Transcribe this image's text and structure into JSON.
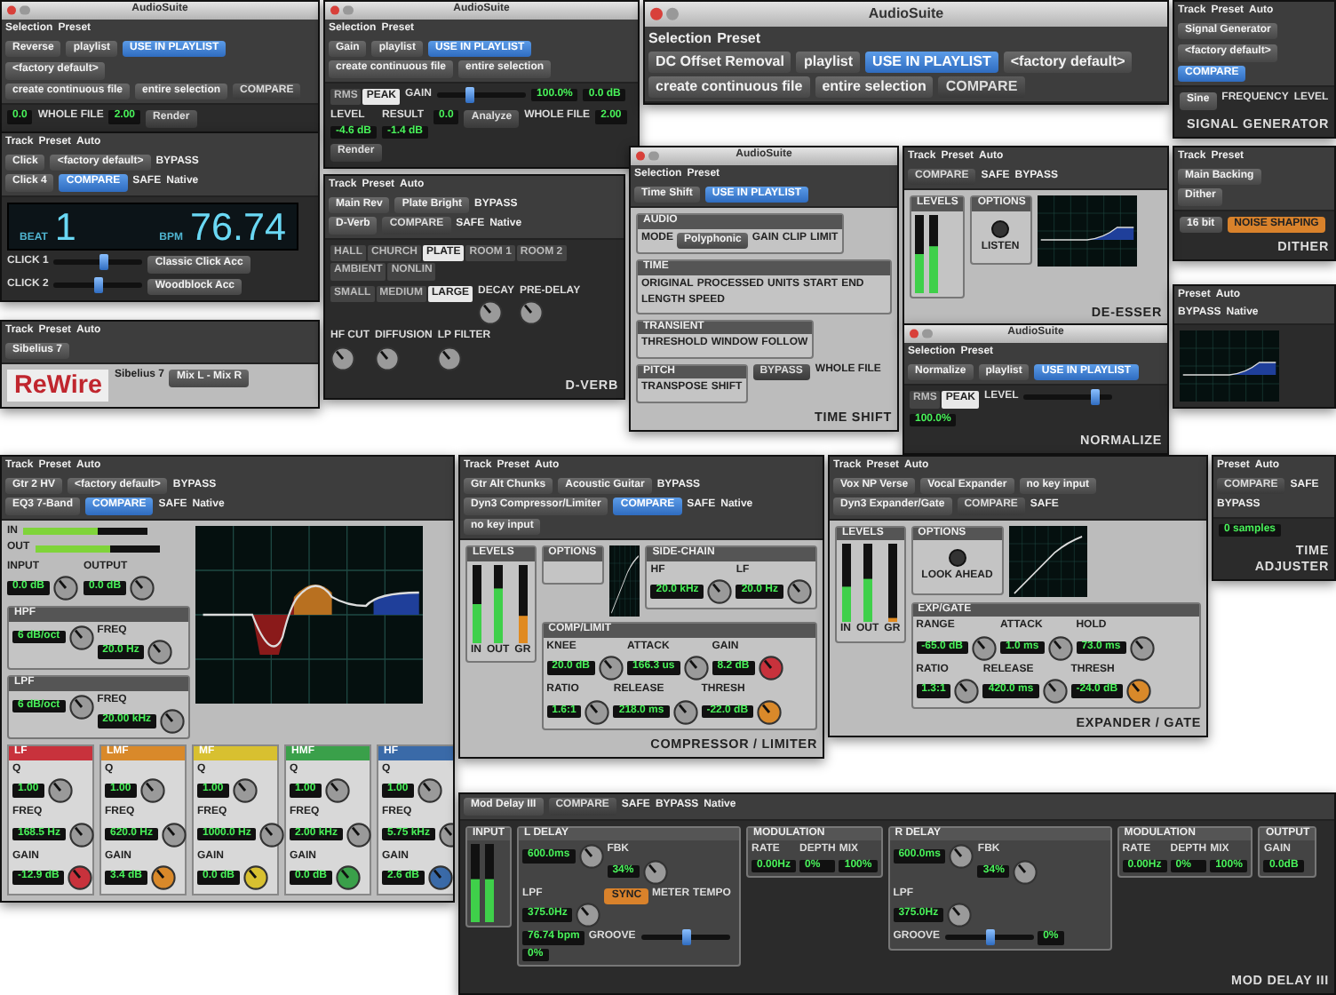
{
  "windows": [
    {
      "header": [
        [
          {
            "kind": "label",
            "text": "Track"
          },
          {
            "kind": "label",
            "text": "Preset"
          },
          {
            "kind": "label",
            "text": "Auto"
          }
        ],
        [
          {
            "kind": "dropdown",
            "text": "Signal Generator"
          },
          {
            "kind": "dropdown",
            "text": "<factory default>"
          }
        ],
        [
          {
            "kind": "button",
            "text": "COMPARE",
            "on": true
          }
        ]
      ],
      "body": [
        {
          "kind": "dropdown",
          "text": "Sine"
        },
        {
          "kind": "text",
          "text": "FREQUENCY"
        },
        {
          "kind": "text",
          "text": "LEVEL"
        },
        {
          "kind": "caption",
          "text": "SIGNAL GENERATOR"
        }
      ]
    },
    {
      "header": [
        [
          {
            "kind": "label",
            "text": "Track"
          },
          {
            "kind": "label",
            "text": "Preset"
          }
        ],
        [
          {
            "kind": "dropdown",
            "text": "Main Backing"
          }
        ],
        [
          {
            "kind": "dropdown",
            "text": "Dither"
          }
        ]
      ],
      "body": [
        {
          "kind": "dropdown",
          "text": "16 bit"
        },
        {
          "kind": "button",
          "text": "NOISE SHAPING",
          "on": true,
          "color": "#d9822b"
        },
        {
          "kind": "caption",
          "text": "DITHER"
        }
      ]
    },
    {
      "title": "AudioSuite",
      "header": [
        [
          {
            "kind": "label",
            "text": "Selection"
          },
          {
            "kind": "label",
            "text": "Preset"
          }
        ],
        [
          {
            "kind": "dropdown",
            "text": "Reverse"
          },
          {
            "kind": "dropdown",
            "text": "playlist"
          },
          {
            "kind": "button",
            "text": "USE IN PLAYLIST",
            "on": true
          },
          {
            "kind": "dropdown",
            "text": "<factory default>"
          }
        ],
        [
          {
            "kind": "dropdown",
            "text": "create continuous file"
          },
          {
            "kind": "dropdown",
            "text": "entire selection"
          },
          {
            "kind": "button",
            "text": "COMPARE",
            "on": false
          }
        ]
      ],
      "body": [
        {
          "kind": "readout",
          "value": "0.0"
        },
        {
          "kind": "text",
          "text": "WHOLE FILE"
        },
        {
          "kind": "readout",
          "value": "2.00"
        },
        {
          "kind": "button",
          "text": "Render",
          "on": false
        }
      ]
    },
    {
      "title": "AudioSuite",
      "header": [
        [
          {
            "kind": "label",
            "text": "Selection"
          },
          {
            "kind": "label",
            "text": "Preset"
          }
        ],
        [
          {
            "kind": "dropdown",
            "text": "Gain"
          },
          {
            "kind": "dropdown",
            "text": "playlist"
          },
          {
            "kind": "button",
            "text": "USE IN PLAYLIST",
            "on": true
          }
        ],
        [
          {
            "kind": "dropdown",
            "text": "create continuous file"
          },
          {
            "kind": "dropdown",
            "text": "entire selection"
          }
        ]
      ],
      "body": [
        {
          "kind": "tabs",
          "items": [
            {
              "label": "RMS",
              "selected": false
            },
            {
              "label": "PEAK",
              "selected": true
            }
          ]
        },
        {
          "kind": "slider",
          "label": "GAIN",
          "level": 0.35
        },
        {
          "kind": "readout",
          "value": "100.0%"
        },
        {
          "kind": "readout",
          "value": "0.0 dB"
        },
        {
          "kind": "readout",
          "label": "LEVEL",
          "value": "-4.6 dB"
        },
        {
          "kind": "readout",
          "label": "RESULT",
          "value": "-1.4 dB"
        },
        {
          "kind": "readout",
          "value": "0.0"
        },
        {
          "kind": "button",
          "text": "Analyze",
          "on": false
        },
        {
          "kind": "text",
          "text": "WHOLE FILE"
        },
        {
          "kind": "readout",
          "value": "2.00"
        },
        {
          "kind": "button",
          "text": "Render",
          "on": false
        }
      ]
    },
    {
      "header": [
        [
          {
            "kind": "label",
            "text": "Track"
          },
          {
            "kind": "label",
            "text": "Preset"
          },
          {
            "kind": "label",
            "text": "Auto"
          }
        ],
        [
          {
            "kind": "dropdown",
            "text": "Click"
          },
          {
            "kind": "dropdown",
            "text": "<factory default>"
          },
          {
            "kind": "label",
            "text": "BYPASS"
          }
        ],
        [
          {
            "kind": "dropdown",
            "text": "Click 4"
          },
          {
            "kind": "button",
            "text": "COMPARE",
            "on": true
          },
          {
            "kind": "label",
            "text": "SAFE"
          },
          {
            "kind": "label",
            "text": "Native"
          }
        ]
      ],
      "body": [
        {
          "kind": "display",
          "items": [
            {
              "label": "BEAT",
              "value": "1"
            },
            {
              "label": "BPM",
              "value": "76.74"
            }
          ]
        },
        {
          "kind": "slider",
          "label": "CLICK 1",
          "level": 0.55
        },
        {
          "kind": "dropdown",
          "text": "Classic Click Acc"
        },
        {
          "kind": "slider",
          "label": "CLICK 2",
          "level": 0.5
        },
        {
          "kind": "dropdown",
          "text": "Woodblock Acc"
        }
      ]
    },
    {
      "header": [
        [
          {
            "kind": "label",
            "text": "Track"
          },
          {
            "kind": "label",
            "text": "Preset"
          },
          {
            "kind": "label",
            "text": "Auto"
          }
        ],
        [
          {
            "kind": "dropdown",
            "text": "Sibelius 7"
          }
        ]
      ],
      "body": [
        {
          "kind": "logo",
          "text": "ReWire"
        },
        {
          "kind": "text",
          "text": "Sibelius 7"
        },
        {
          "kind": "dropdown",
          "text": "Mix L - Mix R"
        }
      ]
    },
    {
      "header": [
        [
          {
            "kind": "label",
            "text": "Track"
          },
          {
            "kind": "label",
            "text": "Preset"
          },
          {
            "kind": "label",
            "text": "Auto"
          }
        ],
        [
          {
            "kind": "dropdown",
            "text": "Main Rev"
          },
          {
            "kind": "dropdown",
            "text": "Plate Bright"
          },
          {
            "kind": "label",
            "text": "BYPASS"
          }
        ],
        [
          {
            "kind": "dropdown",
            "text": "D-Verb"
          },
          {
            "kind": "button",
            "text": "COMPARE",
            "on": false
          },
          {
            "kind": "label",
            "text": "SAFE"
          },
          {
            "kind": "label",
            "text": "Native"
          }
        ]
      ],
      "body": [
        {
          "kind": "tabs",
          "items": [
            {
              "label": "HALL",
              "selected": false
            },
            {
              "label": "CHURCH",
              "selected": false
            },
            {
              "label": "PLATE",
              "selected": true
            },
            {
              "label": "ROOM 1",
              "selected": false
            },
            {
              "label": "ROOM 2",
              "selected": false
            },
            {
              "label": "AMBIENT",
              "selected": false
            },
            {
              "label": "NONLIN",
              "selected": false
            }
          ]
        },
        {
          "kind": "tabs",
          "items": [
            {
              "label": "SMALL",
              "selected": false
            },
            {
              "label": "MEDIUM",
              "selected": false
            },
            {
              "label": "LARGE",
              "selected": true
            }
          ]
        },
        {
          "kind": "knob",
          "label": "DECAY"
        },
        {
          "kind": "knob",
          "label": "PRE-DELAY"
        },
        {
          "kind": "knob",
          "label": "HF CUT"
        },
        {
          "kind": "knob",
          "label": "DIFFUSION"
        },
        {
          "kind": "knob",
          "label": "LP FILTER"
        },
        {
          "kind": "caption",
          "text": "D-VERB"
        }
      ]
    },
    {
      "title": "AudioSuite",
      "header": [
        [
          {
            "kind": "label",
            "text": "Selection"
          },
          {
            "kind": "label",
            "text": "Preset"
          }
        ],
        [
          {
            "kind": "dropdown",
            "text": "DC Offset Removal"
          },
          {
            "kind": "dropdown",
            "text": "playlist"
          },
          {
            "kind": "button",
            "text": "USE IN PLAYLIST",
            "on": true
          },
          {
            "kind": "dropdown",
            "text": "<factory default>"
          }
        ],
        [
          {
            "kind": "dropdown",
            "text": "create continuous file"
          },
          {
            "kind": "dropdown",
            "text": "entire selection"
          },
          {
            "kind": "button",
            "text": "COMPARE",
            "on": false
          }
        ]
      ]
    },
    {
      "title": "AudioSuite",
      "header": [
        [
          {
            "kind": "label",
            "text": "Selection"
          },
          {
            "kind": "label",
            "text": "Preset"
          }
        ],
        [
          {
            "kind": "dropdown",
            "text": "Time Shift"
          },
          {
            "kind": "button",
            "text": "USE IN PLAYLIST",
            "on": true
          }
        ]
      ],
      "body": [
        {
          "kind": "group",
          "title": "AUDIO",
          "body": [
            {
              "kind": "text",
              "text": "MODE"
            },
            {
              "kind": "dropdown",
              "text": "Polyphonic"
            },
            {
              "kind": "text",
              "text": "GAIN"
            },
            {
              "kind": "text",
              "text": "CLIP"
            },
            {
              "kind": "text",
              "text": "LIMIT"
            }
          ]
        },
        {
          "kind": "group",
          "title": "TIME",
          "body": [
            {
              "kind": "text",
              "text": "ORIGINAL"
            },
            {
              "kind": "text",
              "text": "PROCESSED"
            },
            {
              "kind": "text",
              "text": "UNITS"
            },
            {
              "kind": "text",
              "text": "START"
            },
            {
              "kind": "text",
              "text": "END"
            },
            {
              "kind": "text",
              "text": "LENGTH"
            },
            {
              "kind": "text",
              "text": "SPEED"
            }
          ]
        },
        {
          "kind": "group",
          "title": "TRANSIENT",
          "body": [
            {
              "kind": "text",
              "text": "THRESHOLD"
            },
            {
              "kind": "text",
              "text": "WINDOW"
            },
            {
              "kind": "text",
              "text": "FOLLOW"
            }
          ]
        },
        {
          "kind": "group",
          "title": "PITCH",
          "body": [
            {
              "kind": "text",
              "text": "TRANSPOSE"
            },
            {
              "kind": "text",
              "text": "SHIFT"
            }
          ]
        },
        {
          "kind": "button",
          "text": "BYPASS",
          "on": false
        },
        {
          "kind": "text",
          "text": "WHOLE FILE"
        },
        {
          "kind": "caption",
          "text": "TIME SHIFT"
        }
      ]
    },
    {
      "header": [
        [
          {
            "kind": "label",
            "text": "Track"
          },
          {
            "kind": "label",
            "text": "Preset"
          },
          {
            "kind": "label",
            "text": "Auto"
          }
        ],
        [
          {
            "kind": "button",
            "text": "COMPARE",
            "on": false
          },
          {
            "kind": "label",
            "text": "SAFE"
          },
          {
            "kind": "label",
            "text": "BYPASS"
          }
        ]
      ],
      "body": [
        {
          "kind": "group",
          "title": "LEVELS",
          "body": [
            {
              "kind": "meter",
              "channels": [
                {
                  "level": 0.5
                },
                {
                  "level": 0.6
                }
              ]
            }
          ]
        },
        {
          "kind": "group",
          "title": "OPTIONS",
          "body": [
            {
              "kind": "led",
              "text": "LISTEN"
            }
          ]
        },
        {
          "kind": "shelf-graph"
        },
        {
          "kind": "caption",
          "text": "DE-ESSER"
        }
      ]
    },
    {
      "title": "AudioSuite",
      "header": [
        [
          {
            "kind": "label",
            "text": "Selection"
          },
          {
            "kind": "label",
            "text": "Preset"
          }
        ],
        [
          {
            "kind": "dropdown",
            "text": "Normalize"
          },
          {
            "kind": "dropdown",
            "text": "playlist"
          },
          {
            "kind": "button",
            "text": "USE IN PLAYLIST",
            "on": true
          }
        ]
      ],
      "body": [
        {
          "kind": "tabs",
          "items": [
            {
              "label": "RMS",
              "selected": false
            },
            {
              "label": "PEAK",
              "selected": true
            }
          ]
        },
        {
          "kind": "slider",
          "label": "LEVEL",
          "level": 0.8
        },
        {
          "kind": "readout",
          "value": "100.0%"
        },
        {
          "kind": "caption",
          "text": "NORMALIZE"
        }
      ]
    },
    {
      "header": [
        [
          {
            "kind": "label",
            "text": "Preset"
          },
          {
            "kind": "label",
            "text": "Auto"
          }
        ],
        [
          {
            "kind": "label",
            "text": "BYPASS"
          },
          {
            "kind": "label",
            "text": "Native"
          }
        ]
      ],
      "body": [
        {
          "kind": "shelf-graph"
        }
      ]
    },
    {
      "header": [
        [
          {
            "kind": "label",
            "text": "Track"
          },
          {
            "kind": "label",
            "text": "Preset"
          },
          {
            "kind": "label",
            "text": "Auto"
          }
        ],
        [
          {
            "kind": "dropdown",
            "text": "Gtr 2 HV"
          },
          {
            "kind": "dropdown",
            "text": "<factory default>"
          },
          {
            "kind": "label",
            "text": "BYPASS"
          }
        ],
        [
          {
            "kind": "dropdown",
            "text": "EQ3 7-Band"
          },
          {
            "kind": "button",
            "text": "COMPARE",
            "on": true
          },
          {
            "kind": "label",
            "text": "SAFE"
          },
          {
            "kind": "label",
            "text": "Native"
          }
        ]
      ],
      "body": [
        {
          "kind": "row",
          "body": [
            {
              "kind": "column",
              "body": [
                {
                  "kind": "hmeter",
                  "channels": [
                    {
                      "label": "IN",
                      "level": 0.6
                    },
                    {
                      "label": "OUT",
                      "level": 0.6
                    }
                  ]
                },
                {
                  "kind": "row",
                  "body": [
                    {
                      "kind": "knob",
                      "label": "INPUT",
                      "value": "0.0 dB"
                    },
                    {
                      "kind": "knob",
                      "label": "OUTPUT",
                      "value": "0.0 dB"
                    }
                  ]
                },
                {
                  "kind": "group",
                  "title": "HPF",
                  "body": [
                    {
                      "kind": "knob",
                      "value": "6 dB/oct"
                    },
                    {
                      "kind": "knob",
                      "label": "FREQ",
                      "value": "20.0 Hz"
                    }
                  ]
                },
                {
                  "kind": "group",
                  "title": "LPF",
                  "body": [
                    {
                      "kind": "knob",
                      "value": "6 dB/oct"
                    },
                    {
                      "kind": "knob",
                      "label": "FREQ",
                      "value": "20.00 kHz"
                    }
                  ]
                }
              ]
            },
            {
              "kind": "eq-graph"
            }
          ]
        },
        {
          "kind": "row",
          "body": [
            {
              "kind": "band",
              "name": "LF",
              "color": "#c8323c",
              "body": [
                {
                  "kind": "knob",
                  "label": "Q",
                  "value": "1.00"
                },
                {
                  "kind": "knob",
                  "label": "FREQ",
                  "value": "168.5 Hz"
                },
                {
                  "kind": "knob",
                  "label": "GAIN",
                  "value": "-12.9 dB",
                  "color": "#c8323c"
                }
              ]
            },
            {
              "kind": "band",
              "name": "LMF",
              "color": "#d9892a",
              "body": [
                {
                  "kind": "knob",
                  "label": "Q",
                  "value": "1.00"
                },
                {
                  "kind": "knob",
                  "label": "FREQ",
                  "value": "620.0 Hz"
                },
                {
                  "kind": "knob",
                  "label": "GAIN",
                  "value": "3.4 dB",
                  "color": "#d9892a"
                }
              ]
            },
            {
              "kind": "band",
              "name": "MF",
              "color": "#d8c030",
              "body": [
                {
                  "kind": "knob",
                  "label": "Q",
                  "value": "1.00"
                },
                {
                  "kind": "knob",
                  "label": "FREQ",
                  "value": "1000.0 Hz"
                },
                {
                  "kind": "knob",
                  "label": "GAIN",
                  "value": "0.0 dB",
                  "color": "#d8c030"
                }
              ]
            },
            {
              "kind": "band",
              "name": "HMF",
              "color": "#3aa04a",
              "body": [
                {
                  "kind": "knob",
                  "label": "Q",
                  "value": "1.00"
                },
                {
                  "kind": "knob",
                  "label": "FREQ",
                  "value": "2.00 kHz"
                },
                {
                  "kind": "knob",
                  "label": "GAIN",
                  "value": "0.0 dB",
                  "color": "#3aa04a"
                }
              ]
            },
            {
              "kind": "band",
              "name": "HF",
              "color": "#3a6aa8",
              "body": [
                {
                  "kind": "knob",
                  "label": "Q",
                  "value": "1.00"
                },
                {
                  "kind": "knob",
                  "label": "FREQ",
                  "value": "5.75 kHz"
                },
                {
                  "kind": "knob",
                  "label": "GAIN",
                  "value": "2.6 dB",
                  "color": "#3a6aa8"
                }
              ]
            }
          ]
        }
      ]
    },
    {
      "header": [
        [
          {
            "kind": "label",
            "text": "Track"
          },
          {
            "kind": "label",
            "text": "Preset"
          },
          {
            "kind": "label",
            "text": "Auto"
          }
        ],
        [
          {
            "kind": "dropdown",
            "text": "Gtr Alt Chunks"
          },
          {
            "kind": "dropdown",
            "text": "Acoustic Guitar"
          },
          {
            "kind": "label",
            "text": "BYPASS"
          }
        ],
        [
          {
            "kind": "dropdown",
            "text": "Dyn3 Compressor/Limiter"
          },
          {
            "kind": "button",
            "text": "COMPARE",
            "on": true
          },
          {
            "kind": "label",
            "text": "SAFE"
          },
          {
            "kind": "label",
            "text": "Native"
          }
        ],
        [
          {
            "kind": "dropdown",
            "text": "no key input"
          }
        ]
      ],
      "body": [
        {
          "kind": "row",
          "body": [
            {
              "kind": "group",
              "title": "LEVELS",
              "body": [
                {
                  "kind": "meter",
                  "channels": [
                    {
                      "label": "IN",
                      "level": 0.5
                    },
                    {
                      "label": "OUT",
                      "level": 0.7
                    },
                    {
                      "label": "GR",
                      "level": 0.35
                    }
                  ]
                }
              ]
            },
            {
              "kind": "column",
              "body": [
                {
                  "kind": "row",
                  "body": [
                    {
                      "kind": "group",
                      "title": "OPTIONS"
                    },
                    {
                      "kind": "comp-graph"
                    },
                    {
                      "kind": "group",
                      "title": "SIDE-CHAIN",
                      "body": [
                        {
                          "kind": "knob",
                          "label": "HF",
                          "value": "20.0 kHz"
                        },
                        {
                          "kind": "knob",
                          "label": "LF",
                          "value": "20.0 Hz"
                        }
                      ]
                    }
                  ]
                },
                {
                  "kind": "group",
                  "title": "COMP/LIMIT",
                  "body": [
                    {
                      "kind": "knob",
                      "label": "KNEE",
                      "value": "20.0 dB"
                    },
                    {
                      "kind": "knob",
                      "label": "ATTACK",
                      "value": "166.3 us"
                    },
                    {
                      "kind": "knob",
                      "label": "GAIN",
                      "value": "8.2 dB",
                      "color": "#c8323c"
                    },
                    {
                      "kind": "knob",
                      "label": "RATIO",
                      "value": "1.6:1"
                    },
                    {
                      "kind": "knob",
                      "label": "RELEASE",
                      "value": "218.0 ms"
                    },
                    {
                      "kind": "knob",
                      "label": "THRESH",
                      "value": "-22.0 dB",
                      "color": "#d9892a"
                    }
                  ]
                }
              ]
            }
          ]
        },
        {
          "kind": "caption",
          "text": "COMPRESSOR / LIMITER"
        }
      ]
    },
    {
      "header": [
        [
          {
            "kind": "label",
            "text": "Track"
          },
          {
            "kind": "label",
            "text": "Preset"
          },
          {
            "kind": "label",
            "text": "Auto"
          }
        ],
        [
          {
            "kind": "dropdown",
            "text": "Vox NP Verse"
          },
          {
            "kind": "dropdown",
            "text": "Vocal Expander"
          },
          {
            "kind": "dropdown",
            "text": "no key input"
          }
        ],
        [
          {
            "kind": "dropdown",
            "text": "Dyn3 Expander/Gate"
          },
          {
            "kind": "button",
            "text": "COMPARE",
            "on": false
          },
          {
            "kind": "label",
            "text": "SAFE"
          }
        ]
      ],
      "body": [
        {
          "kind": "row",
          "body": [
            {
              "kind": "group",
              "title": "LEVELS",
              "body": [
                {
                  "kind": "meter",
                  "channels": [
                    {
                      "label": "IN",
                      "level": 0.45
                    },
                    {
                      "label": "OUT",
                      "level": 0.55
                    },
                    {
                      "label": "GR",
                      "level": 0.05
                    }
                  ]
                }
              ]
            },
            {
              "kind": "column",
              "body": [
                {
                  "kind": "row",
                  "body": [
                    {
                      "kind": "group",
                      "title": "OPTIONS",
                      "body": [
                        {
                          "kind": "led",
                          "text": "LOOK AHEAD"
                        }
                      ]
                    },
                    {
                      "kind": "comp-graph"
                    }
                  ]
                },
                {
                  "kind": "group",
                  "title": "EXP/GATE",
                  "body": [
                    {
                      "kind": "knob",
                      "label": "RANGE",
                      "value": "-65.0 dB"
                    },
                    {
                      "kind": "knob",
                      "label": "ATTACK",
                      "value": "1.0 ms"
                    },
                    {
                      "kind": "knob",
                      "label": "HOLD",
                      "value": "73.0 ms"
                    },
                    {
                      "kind": "knob",
                      "label": "RATIO",
                      "value": "1.3:1"
                    },
                    {
                      "kind": "knob",
                      "label": "RELEASE",
                      "value": "420.0 ms"
                    },
                    {
                      "kind": "knob",
                      "label": "THRESH",
                      "value": "-24.0 dB",
                      "color": "#d9892a"
                    }
                  ]
                }
              ]
            }
          ]
        },
        {
          "kind": "caption",
          "text": "EXPANDER / GATE"
        }
      ]
    },
    {
      "header": [
        [
          {
            "kind": "label",
            "text": "Preset"
          },
          {
            "kind": "label",
            "text": "Auto"
          }
        ],
        [
          {
            "kind": "button",
            "text": "COMPARE",
            "on": false
          },
          {
            "kind": "label",
            "text": "SAFE"
          },
          {
            "kind": "label",
            "text": "BYPASS"
          }
        ]
      ],
      "body": [
        {
          "kind": "readout",
          "value": "0 samples"
        },
        {
          "kind": "caption",
          "text": "TIME ADJUSTER"
        }
      ]
    },
    {
      "header": [
        [
          {
            "kind": "dropdown",
            "text": "Mod Delay III"
          },
          {
            "kind": "button",
            "text": "COMPARE",
            "on": false
          },
          {
            "kind": "label",
            "text": "SAFE"
          },
          {
            "kind": "label",
            "text": "BYPASS"
          },
          {
            "kind": "label",
            "text": "Native"
          }
        ]
      ],
      "body": [
        {
          "kind": "row",
          "body": [
            {
              "kind": "group",
              "title": "INPUT",
              "body": [
                {
                  "kind": "meter",
                  "channels": [
                    {
                      "level": 0.55
                    },
                    {
                      "level": 0.55
                    }
                  ]
                }
              ]
            },
            {
              "kind": "group",
              "title": "L DELAY",
              "body": [
                {
                  "kind": "knob",
                  "value": "600.0ms"
                },
                {
                  "kind": "knob",
                  "label": "FBK",
                  "value": "34%"
                },
                {
                  "kind": "knob",
                  "label": "LPF",
                  "value": "375.0Hz"
                },
                {
                  "kind": "button",
                  "text": "SYNC",
                  "on": true,
                  "color": "#d9822b"
                },
                {
                  "kind": "text",
                  "text": "METER"
                },
                {
                  "kind": "text",
                  "text": "TEMPO"
                },
                {
                  "kind": "readout",
                  "value": "76.74 bpm"
                },
                {
                  "kind": "slider",
                  "label": "GROOVE",
                  "level": 0.5
                },
                {
                  "kind": "readout",
                  "value": "0%"
                }
              ]
            },
            {
              "kind": "group",
              "title": "MODULATION",
              "body": [
                {
                  "kind": "readout",
                  "label": "RATE",
                  "value": "0.00Hz"
                },
                {
                  "kind": "readout",
                  "label": "DEPTH",
                  "value": "0%"
                },
                {
                  "kind": "readout",
                  "label": "MIX",
                  "value": "100%"
                }
              ]
            },
            {
              "kind": "group",
              "title": "R DELAY",
              "body": [
                {
                  "kind": "knob",
                  "value": "600.0ms"
                },
                {
                  "kind": "knob",
                  "label": "FBK",
                  "value": "34%"
                },
                {
                  "kind": "knob",
                  "label": "LPF",
                  "value": "375.0Hz"
                },
                {
                  "kind": "slider",
                  "label": "GROOVE",
                  "level": 0.5
                },
                {
                  "kind": "readout",
                  "value": "0%"
                }
              ]
            },
            {
              "kind": "group",
              "title": "MODULATION",
              "body": [
                {
                  "kind": "readout",
                  "label": "RATE",
                  "value": "0.00Hz"
                },
                {
                  "kind": "readout",
                  "label": "DEPTH",
                  "value": "0%"
                },
                {
                  "kind": "readout",
                  "label": "MIX",
                  "value": "100%"
                }
              ]
            },
            {
              "kind": "group",
              "title": "OUTPUT",
              "body": [
                {
                  "kind": "readout",
                  "label": "GAIN",
                  "value": "0.0dB"
                }
              ]
            }
          ]
        },
        {
          "kind": "caption",
          "text": "MOD DELAY III"
        }
      ]
    }
  ]
}
